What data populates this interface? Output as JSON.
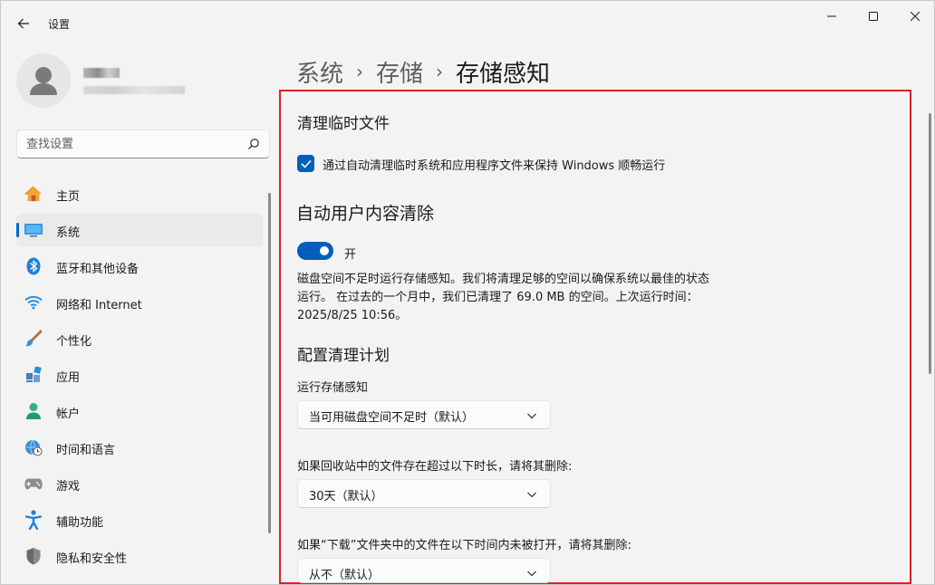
{
  "app": {
    "title": "设置"
  },
  "window_controls": {
    "minimize": "minimize",
    "maximize": "maximize",
    "close": "close"
  },
  "search": {
    "placeholder": "查找设置"
  },
  "sidebar": {
    "items": [
      {
        "label": "主页",
        "icon": "home-icon"
      },
      {
        "label": "系统",
        "icon": "system-icon",
        "active": true
      },
      {
        "label": "蓝牙和其他设备",
        "icon": "bluetooth-icon"
      },
      {
        "label": "网络和 Internet",
        "icon": "wifi-icon"
      },
      {
        "label": "个性化",
        "icon": "brush-icon"
      },
      {
        "label": "应用",
        "icon": "apps-icon"
      },
      {
        "label": "帐户",
        "icon": "account-icon"
      },
      {
        "label": "时间和语言",
        "icon": "globe-clock-icon"
      },
      {
        "label": "游戏",
        "icon": "gamepad-icon"
      },
      {
        "label": "辅助功能",
        "icon": "accessibility-icon"
      },
      {
        "label": "隐私和安全性",
        "icon": "shield-icon"
      }
    ]
  },
  "breadcrumb": {
    "part1": "系统",
    "part2": "存储",
    "current": "存储感知"
  },
  "main": {
    "cleanup_temp": {
      "title": "清理临时文件",
      "checkbox_label": "通过自动清理临时系统和应用程序文件来保持 Windows 顺畅运行",
      "checked": true
    },
    "auto_cleanup": {
      "title": "自动用户内容清除",
      "toggle_label": "开",
      "toggle_on": true,
      "description": "磁盘空间不足时运行存储感知。我们将清理足够的空间以确保系统以最佳的状态运行。 在过去的一个月中，我们已清理了 69.0 MB 的空间。上次运行时间：2025/8/25 10:56。"
    },
    "schedule": {
      "title": "配置清理计划",
      "run_label": "运行存储感知",
      "run_value": "当可用磁盘空间不足时（默认）",
      "recycle_label": "如果回收站中的文件存在超过以下时长，请将其删除:",
      "recycle_value": "30天（默认）",
      "downloads_label": "如果“下载”文件夹中的文件在以下时间内未被打开，请将其删除:",
      "downloads_value": "从不（默认）"
    }
  },
  "colors": {
    "accent": "#005fb8",
    "highlight_border": "#e0201b"
  }
}
